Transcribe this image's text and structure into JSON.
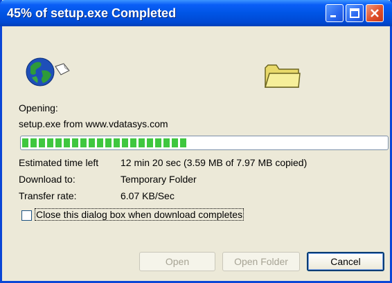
{
  "window": {
    "title": "45% of setup.exe Completed"
  },
  "titlebar_buttons": [
    "minimize",
    "maximize",
    "close"
  ],
  "icons": {
    "download_icon": "globe-with-document-icon",
    "destination_icon": "folder-icon"
  },
  "status": {
    "opening_label": "Opening:",
    "opening_value": "setup.exe from www.vdatasys.com"
  },
  "progress": {
    "percent": 45,
    "fraction": 0.45,
    "color": "#3fc73f"
  },
  "details": {
    "eta_label": "Estimated time left",
    "eta_value": "12 min 20 sec (3.59 MB of 7.97 MB copied)",
    "download_to_label": "Download to:",
    "download_to_value": "Temporary Folder",
    "rate_label": "Transfer rate:",
    "rate_value": "6.07 KB/Sec"
  },
  "option": {
    "close_when_done_label": "Close this dialog box when download completes",
    "checked": false
  },
  "buttons": {
    "open": "Open",
    "open_folder": "Open Folder",
    "cancel": "Cancel"
  },
  "colors": {
    "titlebar": "#0055e5",
    "dialog_bg": "#ece9d8"
  }
}
